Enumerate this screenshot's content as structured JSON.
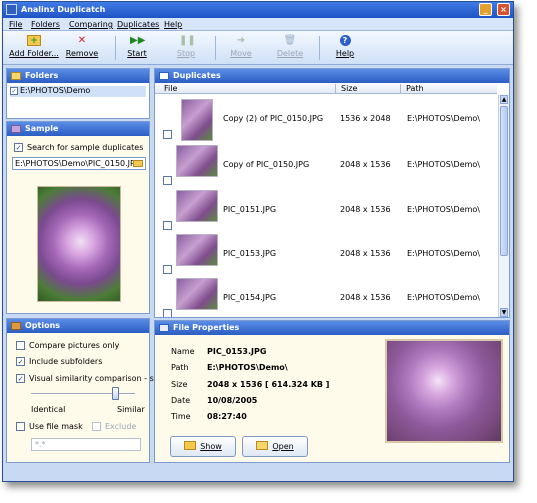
{
  "window": {
    "title": "Analinx Duplicatch"
  },
  "menu": [
    "File",
    "Folders",
    "Comparing",
    "Duplicates",
    "Help"
  ],
  "toolbar": {
    "add_folder": "Add Folder...",
    "remove": "Remove",
    "start": "Start",
    "stop": "Stop",
    "move": "Move",
    "delete": "Delete",
    "help": "Help"
  },
  "folders": {
    "title": "Folders",
    "items": [
      {
        "path": "E:\\PHOTOS\\Demo",
        "checked": true
      }
    ]
  },
  "sample": {
    "title": "Sample",
    "search_label": "Search for sample duplicates",
    "path": "E:\\PHOTOS\\Demo\\PIC_0150.JPG"
  },
  "options": {
    "title": "Options",
    "compare_pictures_only": "Compare pictures only",
    "include_subfolders": "Include subfolders",
    "visual_similarity": "Visual similarity comparison - slow",
    "identical": "Identical",
    "similar": "Similar",
    "use_file_mask": "Use file mask",
    "exclude": "Exclude",
    "mask_value": "*.*"
  },
  "duplicates": {
    "title": "Duplicates",
    "columns": [
      "File",
      "Size",
      "Path"
    ],
    "rows": [
      {
        "file": "Copy (2) of PIC_0150.JPG",
        "size": "1536 x 2048",
        "path": "E:\\PHOTOS\\Demo\\"
      },
      {
        "file": "Copy of PIC_0150.JPG",
        "size": "2048 x 1536",
        "path": "E:\\PHOTOS\\Demo\\"
      },
      {
        "file": "PIC_0151.JPG",
        "size": "2048 x 1536",
        "path": "E:\\PHOTOS\\Demo\\"
      },
      {
        "file": "PIC_0153.JPG",
        "size": "2048 x 1536",
        "path": "E:\\PHOTOS\\Demo\\"
      },
      {
        "file": "PIC_0154.JPG",
        "size": "2048 x 1536",
        "path": "E:\\PHOTOS\\Demo\\"
      }
    ]
  },
  "file_properties": {
    "title": "File Properties",
    "labels": {
      "name": "Name",
      "path": "Path",
      "size": "Size",
      "date": "Date",
      "time": "Time"
    },
    "values": {
      "name": "PIC_0153.JPG",
      "path": "E:\\PHOTOS\\Demo\\",
      "size": "2048 x 1536  [ 614.324 KB ]",
      "date": "10/08/2005",
      "time": "08:27:40"
    },
    "show_button": "Show",
    "open_button": "Open"
  }
}
